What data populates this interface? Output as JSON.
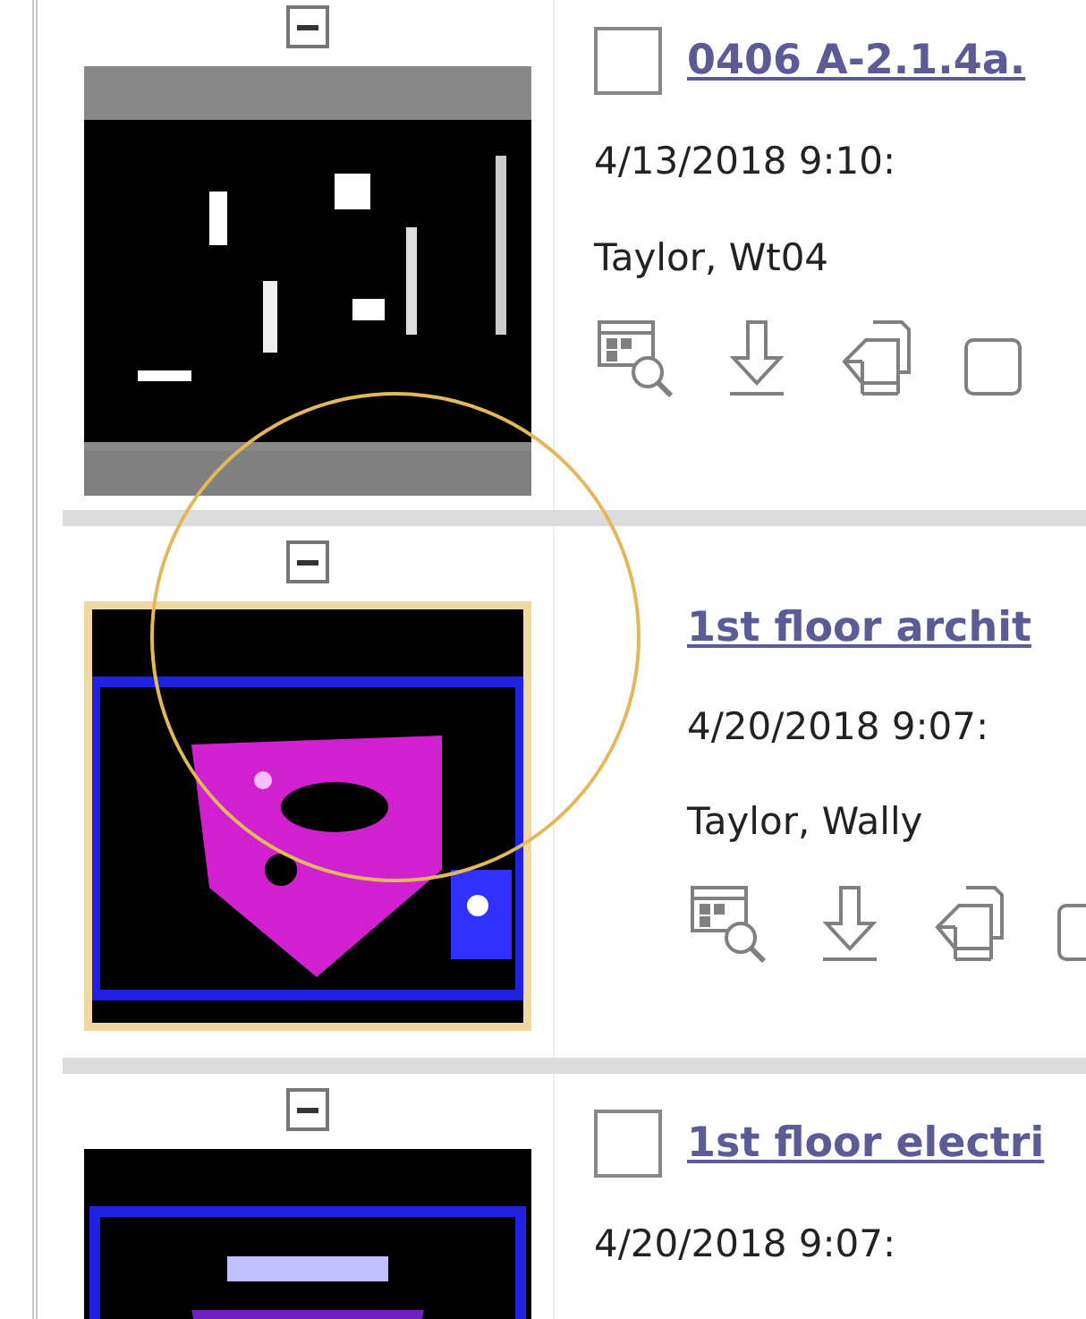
{
  "documents": [
    {
      "title": "0406 A-2.1.4a.",
      "date": "4/13/2018 9:10:",
      "author": "Taylor, Wt04",
      "selected": false,
      "checkbox": {
        "checked": false
      }
    },
    {
      "title": "1st floor archit",
      "date": "4/20/2018 9:07:",
      "author": "Taylor, Wally",
      "selected": true
    },
    {
      "title": "1st floor electri",
      "date": "4/20/2018 9:07:",
      "selected": false,
      "checkbox": {
        "checked": false
      }
    }
  ]
}
